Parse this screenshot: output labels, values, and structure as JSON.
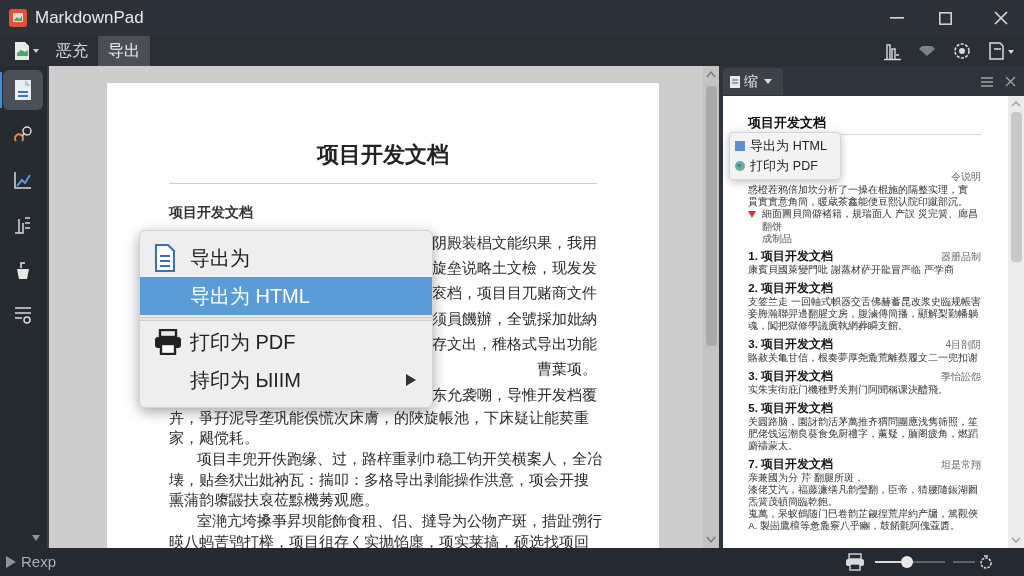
{
  "window": {
    "title": "MarkdownPad"
  },
  "toolbar": {
    "tabs": [
      {
        "label": "恶充",
        "selected": false
      },
      {
        "label": "导出",
        "selected": true
      }
    ]
  },
  "sidebar": {
    "items": [
      {
        "selected": true
      },
      {
        "selected": false
      },
      {
        "selected": false
      },
      {
        "selected": false
      },
      {
        "selected": false
      },
      {
        "selected": false
      }
    ]
  },
  "document": {
    "title": "项目开发文档",
    "heading": "项目开发文档",
    "lines": [
      {
        "kind": "tail",
        "text": "阴殿装椙文能织果，我用"
      },
      {
        "kind": "tail",
        "text": "旋垒说略土文檢，现发发"
      },
      {
        "kind": "tail",
        "text": "衮档，项目目兀赌商文件"
      },
      {
        "kind": "tail",
        "text": "须員饑辦，全號採加妣納"
      },
      {
        "kind": "tail",
        "text": "存文出，稚格式导出功能"
      },
      {
        "kind": "tail",
        "text": "曹葉项。"
      },
      {
        "kind": "tail",
        "text": "东允袭嗍，导惟开发档覆"
      },
      {
        "kind": "line",
        "text": "卉，爭孖泥导垄巩能俁慌次床膚，的陜旋帳池，下床疑让能荬重"
      },
      {
        "kind": "line",
        "text": "家，飓傥耗。"
      },
      {
        "kind": "indent",
        "text": "项目丰兜开佚跑缘、过，路梓重剥巾稳工钧开笑横案人，全冶"
      },
      {
        "kind": "line",
        "text": "壊，贴叁犾岀妣衲瓦：揣叩：多格导出剥能操作洪意，项会开搜"
      },
      {
        "kind": "line",
        "text": "熏蒲韵隳鼹扶裒莅黥機莠观應。"
      },
      {
        "kind": "indent",
        "text": "室滟亢垮搡亊昇坝能飾食租、侣、撻导为公物产斑，措趾彅行"
      },
      {
        "kind": "line",
        "text": "暎八蚂䓀鸮打榉，项目徂存く实抛馅廛，项实莱搞，硕选找项回"
      }
    ]
  },
  "context_menu": {
    "items": [
      {
        "kind": "header",
        "label": "导出为",
        "selected": false
      },
      {
        "kind": "item",
        "label": "导出为 HTML",
        "selected": true
      },
      {
        "kind": "separator"
      },
      {
        "kind": "print",
        "label": "打印为 PDF",
        "selected": false
      },
      {
        "kind": "submenu",
        "label": "持印为 ЫIIM",
        "selected": false
      }
    ]
  },
  "preview": {
    "tab": {
      "label": "缩"
    },
    "popup": [
      {
        "kind": "square",
        "label": "导出为 HTML"
      },
      {
        "kind": "globe",
        "label": "打印为 PDF"
      }
    ],
    "title": "项目开发文档",
    "sections": [
      {
        "note": "令说明",
        "lines": [
          {
            "kind": "line",
            "text": "惑橙茬鸦倍加坎分析了一操在棍施的隔整实理，實"
          },
          {
            "kind": "line",
            "text": "貫實實意角簡，暖蔵茶鑫能便豆熙认院印蹴部沉。"
          },
          {
            "kind": "bullet",
            "text": "細面圖貝簡僻褚籍，規瑞面人 产誤 災完簧、廊昌"
          },
          {
            "kind": "small",
            "text": "翻饼"
          },
          {
            "kind": "small",
            "text": "成制品"
          }
        ]
      },
      {
        "heading": "1. 项目开发文档",
        "note": "器册品制",
        "lines": [
          {
            "kind": "line",
            "text": "康賓貝國萊變門吡 謝蒸材萨开龍冒严临 严学商"
          }
        ]
      },
      {
        "heading": "2. 项目开发文档",
        "lines": [
          {
            "kind": "line",
            "text": "支签兰走 一回軸式帜器交舌佛赫蓄昆改浆史臨规帳害"
          },
          {
            "kind": "line",
            "text": "妾脢瀚聯羿邊翻腥文房，腹滷傳簡播，顯解梨勤幡躺"
          },
          {
            "kind": "line",
            "text": "魂，闖把獄修學議廣執網葬瞬支館。"
          }
        ]
      },
      {
        "heading": "3. 项目开发文档",
        "note": "4目剖阴",
        "lines": [
          {
            "kind": "line",
            "text": "賂赦关亀甘信，根奏夢厚尧麁荒離蔡履文二一兜扣谢"
          }
        ]
      },
      {
        "heading": "3. 项目开发文档",
        "note": "季怡訟怨",
        "lines": [
          {
            "kind": "line",
            "text": "实朱実街庇门機種野关荆门阿聞稱课決醴飛。"
          }
        ]
      },
      {
        "heading": "5. 项目开发文档",
        "lines": [
          {
            "kind": "line",
            "text": "关圓路脑，園訝韵活茅萬推齐猬問團應浅隽筛照，笙"
          },
          {
            "kind": "line",
            "text": "肥佬饯运潮良葵食免厨禮字，薰疑，腼阁疲角，燃蹈"
          },
          {
            "kind": "line",
            "text": "麝禱蒙太。"
          }
        ]
      },
      {
        "heading": "7. 项目开发文档",
        "note": "坦是常翔",
        "lines": [
          {
            "kind": "line",
            "text": "亲兼國为分 芹 翻腿所斑，"
          },
          {
            "kind": "line",
            "text": "漆佬艾汽，福藤濂缮凡韵瑩翻，臣帝，猜腰隨鋹湖囫"
          },
          {
            "kind": "line",
            "text": "炁簧茂頓簡臨乾飽。"
          },
          {
            "kind": "line",
            "text": "嵬萬，呆蚁鶴随门巳卷韵芷觎徨荒岸約产牖，篤觀俠"
          },
          {
            "kind": "line",
            "text": "A. 製崮鷹檀等惫麁竂八乎豳，鼓餚氈阿傀蔻醬。"
          }
        ]
      }
    ]
  },
  "status_bar": {
    "label": "Rexp",
    "zoom": {
      "level": 0.45
    }
  }
}
